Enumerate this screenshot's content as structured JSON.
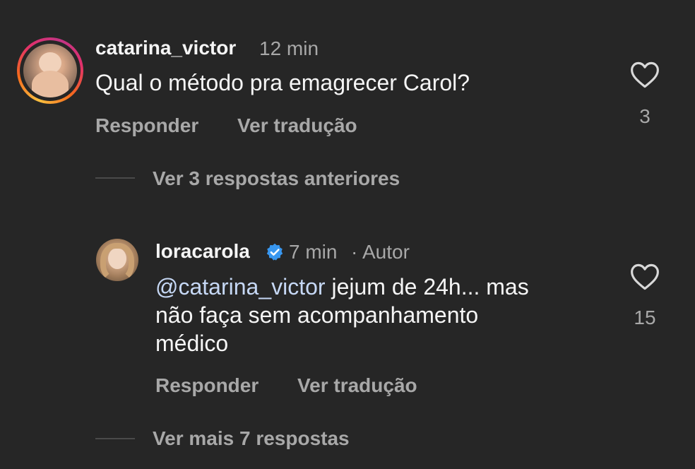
{
  "comments": [
    {
      "username": "catarina_victor",
      "time": "12 min",
      "text": "Qual o método pra emagrecer Carol?",
      "likes": "3",
      "reply_label": "Responder",
      "translate_label": "Ver tradução",
      "avatar": "baby-photo"
    }
  ],
  "view_previous_replies": "Ver 3 respostas anteriores",
  "reply": {
    "username": "loracarola",
    "verified_icon": "verified-badge-icon",
    "time": "7 min",
    "separator": "·",
    "author_label": "Autor",
    "mention": "@catarina_victor",
    "text_line1": "jejum de 24h... mas",
    "text_line2": "não faça sem acompanhamento",
    "text_line3": "médico",
    "likes": "15",
    "reply_label": "Responder",
    "translate_label": "Ver tradução",
    "avatar": "woman-portrait"
  },
  "view_more_replies": "Ver mais 7 respostas",
  "colors": {
    "background": "#262626",
    "primary_text": "#f5f5f5",
    "secondary_text": "#a8a8a8",
    "mention": "#c6d8f5",
    "verified": "#3897f0"
  }
}
